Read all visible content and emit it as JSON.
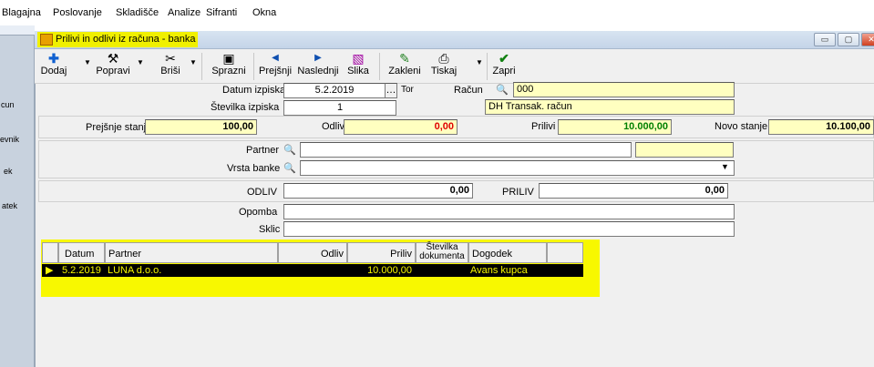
{
  "menu": [
    "Blagajna",
    "Poslovanje",
    "Skladišče",
    "Analize",
    "Sifranti",
    "Okna"
  ],
  "left_labels": [
    "cun",
    "evnik",
    "ek",
    "atek"
  ],
  "window": {
    "title": "Prilivi in odlivi iz računa - banka"
  },
  "toolbar": {
    "dodaj": "Dodaj",
    "popravi": "Popravi",
    "brisi": "Briši",
    "sprazni": "Sprazni",
    "prejsnji": "Prejšnji",
    "naslednji": "Naslednji",
    "slika": "Slika",
    "zakleni": "Zakleni",
    "tiskaj": "Tiskaj",
    "zapri": "Zapri"
  },
  "form": {
    "datum_izpiska_label": "Datum izpiska",
    "datum_izpiska": "5.2.2019",
    "day": "Tor",
    "stevilka_izpiska_label": "Številka izpiska",
    "stevilka_izpiska": "1",
    "racun_label": "Račun",
    "racun": "000",
    "racun_name": "DH Transak. račun",
    "prejsnje_stanje_label": "Prejšnje stanje",
    "prejsnje_stanje": "100,00",
    "odlivi_label": "Odlivi",
    "odlivi": "0,00",
    "prilivi_label": "Prilivi",
    "prilivi": "10.000,00",
    "novo_stanje_label": "Novo stanje",
    "novo_stanje": "10.100,00",
    "partner_label": "Partner",
    "partner": "",
    "vrsta_banke_label": "Vrsta banke",
    "vrsta_banke": "",
    "odliv_label": "ODLIV",
    "odliv": "0,00",
    "priliv_label": "PRILIV",
    "priliv": "0,00",
    "opomba_label": "Opomba",
    "opomba": "",
    "sklic_label": "Sklic",
    "sklic": ""
  },
  "grid": {
    "columns": [
      "Datum",
      "Partner",
      "Odliv",
      "Priliv",
      "Številka dokumenta",
      "Dogodek"
    ],
    "rows": [
      {
        "datum": "5.2.2019",
        "partner": "LUNA d.o.o.",
        "odliv": "",
        "priliv": "10.000,00",
        "stevilka": "",
        "dogodek": "Avans kupca"
      }
    ]
  },
  "colors": {
    "highlight": "#f8f800",
    "yellow_field": "#ffffc0",
    "green_value": "#008000",
    "red_value": "#e00000"
  }
}
